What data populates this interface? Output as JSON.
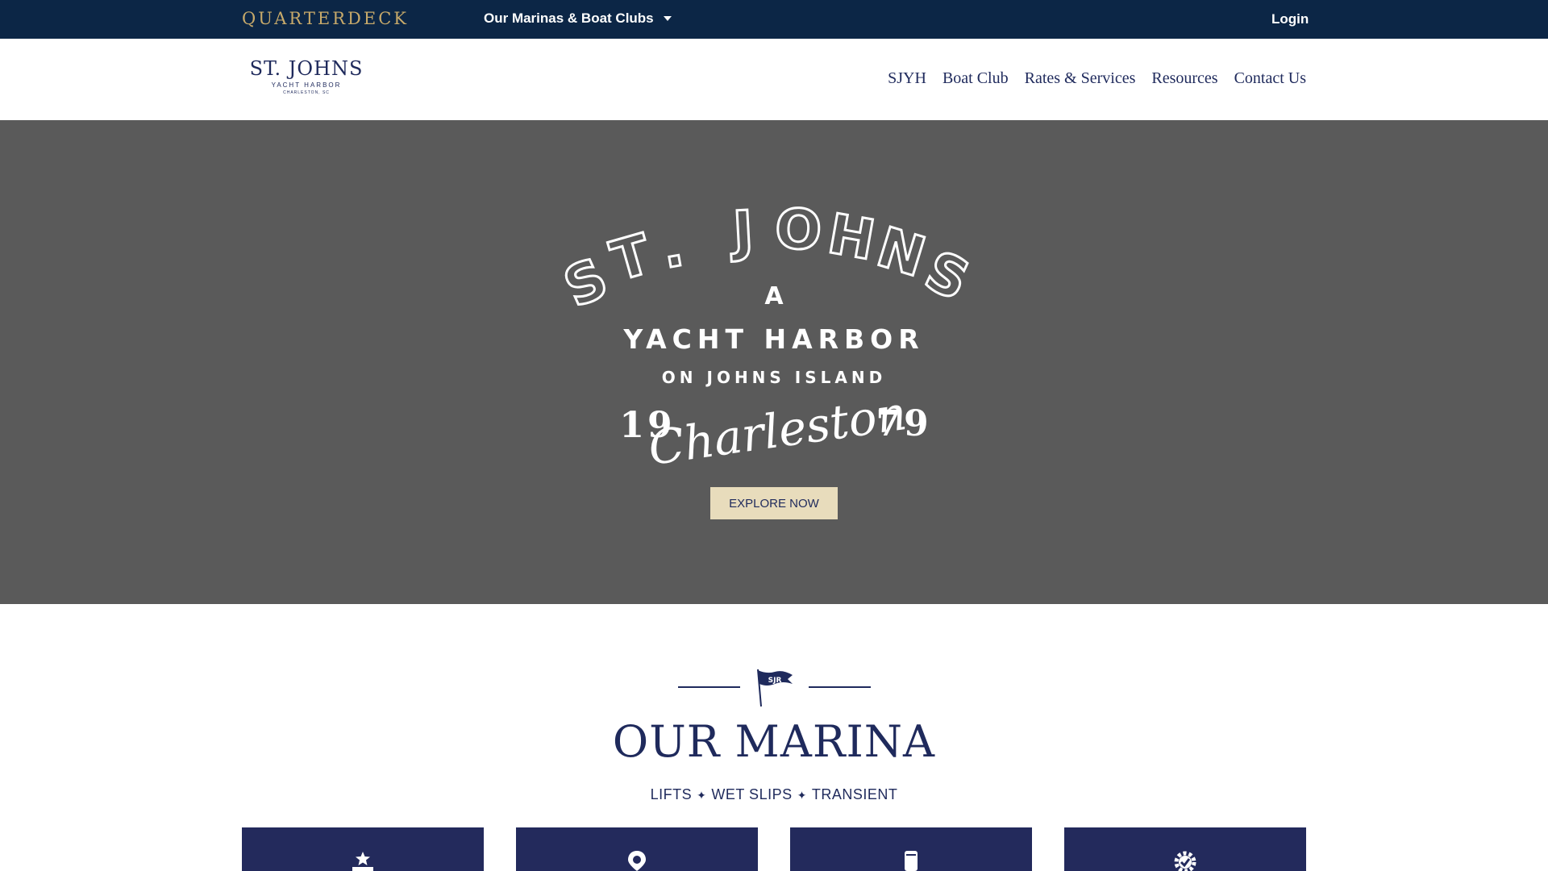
{
  "topbar": {
    "brand": "QUARTERDECK",
    "marinas_menu": "Our Marinas & Boat Clubs",
    "login": "Login"
  },
  "header": {
    "logo": {
      "main": "ST. JOHNS",
      "sub": "YACHT HARBOR",
      "sub2": "CHARLESTON, SC"
    },
    "nav": [
      "SJYH",
      "Boat Club",
      "Rates & Services",
      "Resources",
      "Contact Us"
    ]
  },
  "hero": {
    "arc_letters": [
      "S",
      "T",
      ".",
      "J",
      "O",
      "H",
      "N",
      "S"
    ],
    "a_letter": "A",
    "yacht_harbor": "YACHT HARBOR",
    "on_johns_island": "ON JOHNS ISLAND",
    "year_left": "19",
    "year_right": "79",
    "script": "Charleston",
    "button": "EXPLORE NOW",
    "background": "#5a5a5a"
  },
  "marina": {
    "title": "OUR MARINA",
    "subtitle_parts": [
      "LIFTS",
      "WET SLIPS",
      "TRANSIENT"
    ],
    "separator": "✦",
    "flag_letters": "SJR",
    "cards": [
      {
        "icon": "star-trophy-icon"
      },
      {
        "icon": "map-pin-icon"
      },
      {
        "icon": "phone-icon"
      },
      {
        "icon": "gear-check-icon"
      }
    ]
  },
  "colors": {
    "topbar": "#0c2646",
    "brand_gold": "#c7a96a",
    "navy": "#1f2a5c",
    "card": "#232a5c",
    "button": "#e8dcbc"
  }
}
